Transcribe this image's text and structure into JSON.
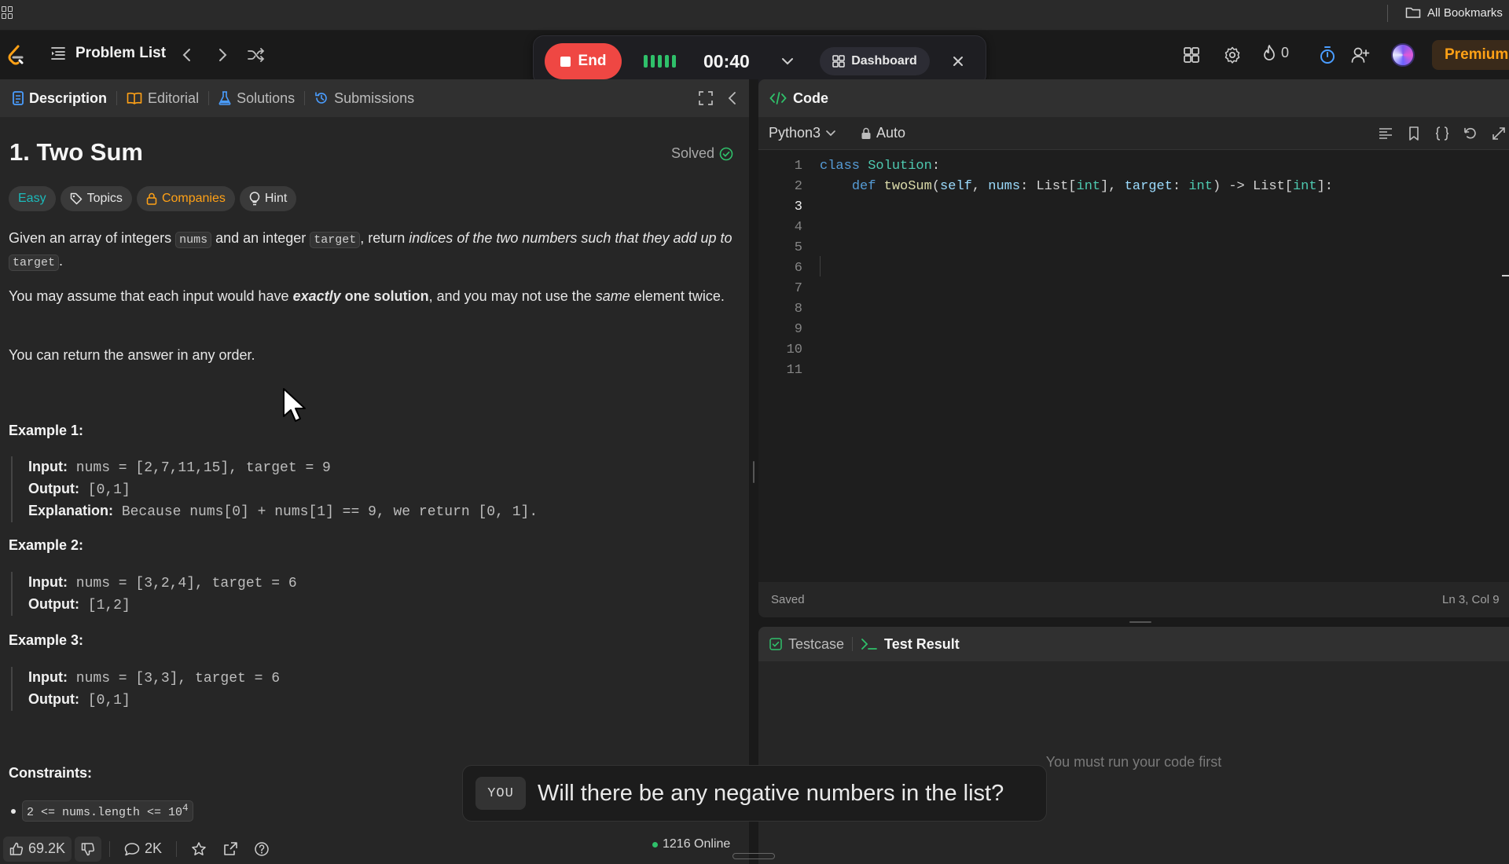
{
  "browser": {
    "all_bookmarks": "All Bookmarks"
  },
  "topnav": {
    "problem_list": "Problem List",
    "end_label": "End",
    "timer": "00:40",
    "dashboard_label": "Dashboard",
    "streak_count": "0",
    "premium_label": "Premium"
  },
  "left_tabs": [
    "Description",
    "Editorial",
    "Solutions",
    "Submissions"
  ],
  "problem": {
    "title": "1. Two Sum",
    "status": "Solved",
    "tags": [
      "Easy",
      "Topics",
      "Companies",
      "Hint"
    ],
    "desc1": {
      "t1": "Given an array of integers ",
      "c1": "nums",
      "t2": " and an integer ",
      "c2": "target",
      "t3": ", return ",
      "em": "indices of the two numbers such that they add up to",
      "t4": " ",
      "c3": "target",
      "t5": "."
    },
    "desc2": {
      "t1": "You may assume that each input would have ",
      "em": "exactly",
      "strong": " one solution",
      "t2": ", and you may not use the ",
      "em2": "same",
      "t3": " element twice."
    },
    "desc3": "You can return the answer in any order.",
    "examples": [
      {
        "title": "Example 1:",
        "input": "nums = [2,7,11,15], target = 9",
        "output": "[0,1]",
        "explanation": "Because nums[0] + nums[1] == 9, we return [0, 1]."
      },
      {
        "title": "Example 2:",
        "input": "nums = [3,2,4], target = 6",
        "output": "[1,2]"
      },
      {
        "title": "Example 3:",
        "input": "nums = [3,3], target = 6",
        "output": "[0,1]"
      }
    ],
    "labels": {
      "input": "Input:",
      "output": "Output:",
      "explanation": "Explanation:"
    },
    "constraints_title": "Constraints:",
    "constraint1": "2 <= nums.length <= 10",
    "constraint1_exp": "4"
  },
  "bottom_bar": {
    "likes": "69.2K",
    "comments": "2K",
    "online": "1216 Online"
  },
  "code_panel": {
    "title": "Code",
    "language": "Python3",
    "auto": "Auto",
    "line_numbers": [
      "1",
      "2",
      "3",
      "4",
      "5",
      "6",
      "7",
      "8",
      "9",
      "10",
      "11"
    ],
    "saved": "Saved",
    "cursor_pos": "Ln 3, Col 9"
  },
  "test_panel": {
    "tabs": [
      "Testcase",
      "Test Result"
    ],
    "empty_msg": "You must run your code first"
  },
  "caption": {
    "speaker": "YOU",
    "message": "Will there be any negative numbers in the list?"
  },
  "colors": {
    "accent": "#ffa116",
    "end": "#ef4743",
    "easy": "#1cbaba",
    "online": "#2fc06a"
  }
}
